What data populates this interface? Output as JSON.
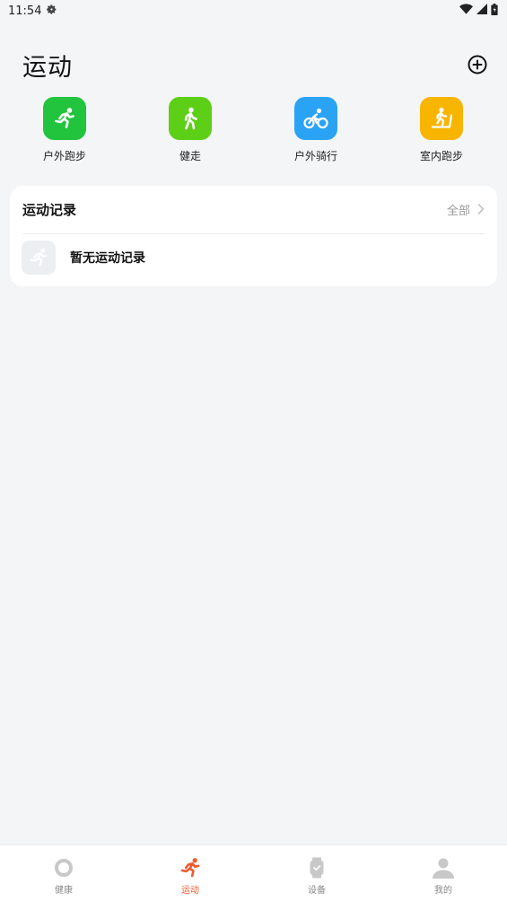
{
  "status_bar": {
    "time": "11:54"
  },
  "header": {
    "title": "运动"
  },
  "quick_sports": [
    {
      "label": "户外跑步",
      "color": "#22c43e",
      "icon": "running-icon"
    },
    {
      "label": "健走",
      "color": "#5ccf16",
      "icon": "walking-icon"
    },
    {
      "label": "户外骑行",
      "color": "#2ba3f5",
      "icon": "cycling-icon"
    },
    {
      "label": "室内跑步",
      "color": "#f7b500",
      "icon": "treadmill-icon"
    }
  ],
  "records": {
    "title": "运动记录",
    "all_label": "全部",
    "empty_text": "暂无运动记录"
  },
  "bottom_nav": [
    {
      "label": "健康",
      "icon": "health-ring-icon",
      "active": false
    },
    {
      "label": "运动",
      "icon": "running-icon",
      "active": true
    },
    {
      "label": "设备",
      "icon": "watch-icon",
      "active": false
    },
    {
      "label": "我的",
      "icon": "person-icon",
      "active": false
    }
  ],
  "colors": {
    "accent": "#ee5a2e",
    "background": "#f4f5f7"
  }
}
